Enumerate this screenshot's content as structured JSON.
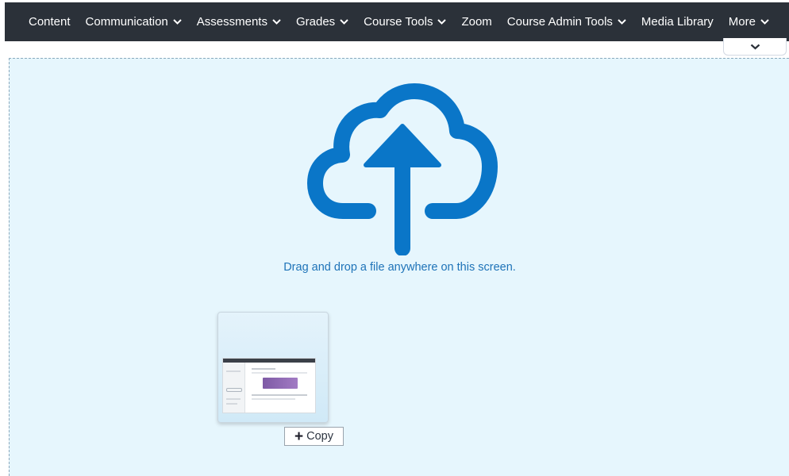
{
  "navbar": {
    "items": [
      {
        "label": "Content",
        "has_dropdown": false
      },
      {
        "label": "Communication",
        "has_dropdown": true
      },
      {
        "label": "Assessments",
        "has_dropdown": true
      },
      {
        "label": "Grades",
        "has_dropdown": true
      },
      {
        "label": "Course Tools",
        "has_dropdown": true
      },
      {
        "label": "Zoom",
        "has_dropdown": false
      },
      {
        "label": "Course Admin Tools",
        "has_dropdown": true
      },
      {
        "label": "Media Library",
        "has_dropdown": false
      },
      {
        "label": "More",
        "has_dropdown": true
      }
    ],
    "collapse_icon": "chevron-down-icon"
  },
  "drop_zone": {
    "icon": "cloud-upload-icon",
    "message": "Drag and drop a file anywhere on this screen."
  },
  "drag_preview": {
    "action_icon": "plus-icon",
    "action_label": "Copy"
  },
  "colors": {
    "navbar_bg": "#2b3139",
    "drop_zone_bg": "#e6f6fd",
    "accent": "#0a76c8"
  }
}
